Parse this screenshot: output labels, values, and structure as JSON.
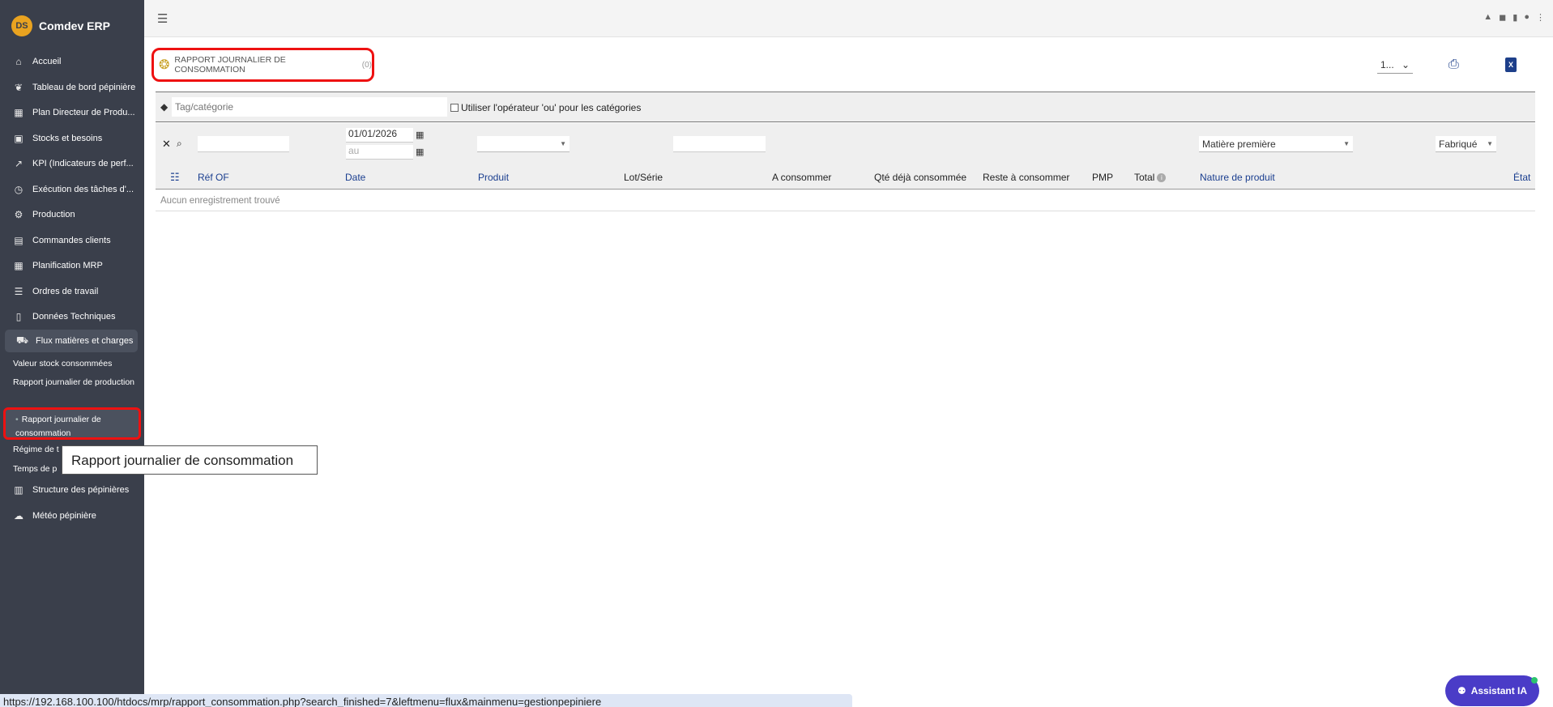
{
  "brand": {
    "logo": "DS",
    "name": "Comdev ERP"
  },
  "sidebar": {
    "items": [
      {
        "icon": "home-icon",
        "glyph": "⌂",
        "label": "Accueil"
      },
      {
        "icon": "leaf-icon",
        "glyph": "❦",
        "label": "Tableau de bord pépinière"
      },
      {
        "icon": "calendar-icon",
        "glyph": "▦",
        "label": "Plan Directeur de Produ..."
      },
      {
        "icon": "boxes-icon",
        "glyph": "▣",
        "label": "Stocks et besoins"
      },
      {
        "icon": "chart-line-icon",
        "glyph": "↗",
        "label": "KPI (Indicateurs de perf..."
      },
      {
        "icon": "clock-icon",
        "glyph": "◷",
        "label": "Exécution des tâches d'..."
      },
      {
        "icon": "cogs-icon",
        "glyph": "⚙",
        "label": "Production"
      },
      {
        "icon": "document-icon",
        "glyph": "▤",
        "label": "Commandes clients"
      },
      {
        "icon": "calendar-icon",
        "glyph": "▦",
        "label": "Planification MRP"
      },
      {
        "icon": "task-list-icon",
        "glyph": "☰",
        "label": "Ordres de travail"
      },
      {
        "icon": "file-icon",
        "glyph": "▯",
        "label": "Données Techniques"
      },
      {
        "icon": "truck-boxes-icon",
        "glyph": "⛟",
        "label": "Flux matières et charges"
      },
      {
        "icon": "building-icon",
        "glyph": "▥",
        "label": "Structure des pépinières"
      },
      {
        "icon": "cloud-sun-icon",
        "glyph": "☁",
        "label": "Météo pépinière"
      }
    ],
    "sub_items": [
      {
        "label": "Valeur stock consommées"
      },
      {
        "label": "Rapport journalier de production"
      },
      {
        "label": "Rapport journalier de consommation"
      },
      {
        "label": "Régime de t"
      },
      {
        "label": "Temps de p"
      }
    ]
  },
  "page": {
    "title": "RAPPORT JOURNALIER DE CONSOMMATION",
    "count": "(0)",
    "page_size": "1..."
  },
  "filters": {
    "tag_placeholder": "Tag/catégorie",
    "or_operator_label": "Utiliser l'opérateur 'ou' pour les catégories",
    "date_from": "01/01/2026",
    "date_to_placeholder": "au",
    "nature": "Matière première",
    "fabrique": "Fabriqué"
  },
  "table": {
    "columns": {
      "ref_of": "Réf OF",
      "date": "Date",
      "produit": "Produit",
      "lot": "Lot/Série",
      "a_consommer": "A consommer",
      "qte_deja": "Qté déjà consommée",
      "reste": "Reste à consommer",
      "pmp": "PMP",
      "total": "Total",
      "nature": "Nature de produit",
      "etat": "État"
    },
    "empty_message": "Aucun enregistrement trouvé"
  },
  "tooltip": "Rapport journalier de consommation",
  "status_url": "https://192.168.100.100/htdocs/mrp/rapport_consommation.php?search_finished=7&leftmenu=flux&mainmenu=gestionpepiniere",
  "assistant": {
    "label": "Assistant IA"
  },
  "colors": {
    "sidebar_bg": "#3a3f4b",
    "link_blue": "#1a3e8f",
    "highlight_red": "#e11111",
    "assistant_purple": "#4a3cc7"
  }
}
